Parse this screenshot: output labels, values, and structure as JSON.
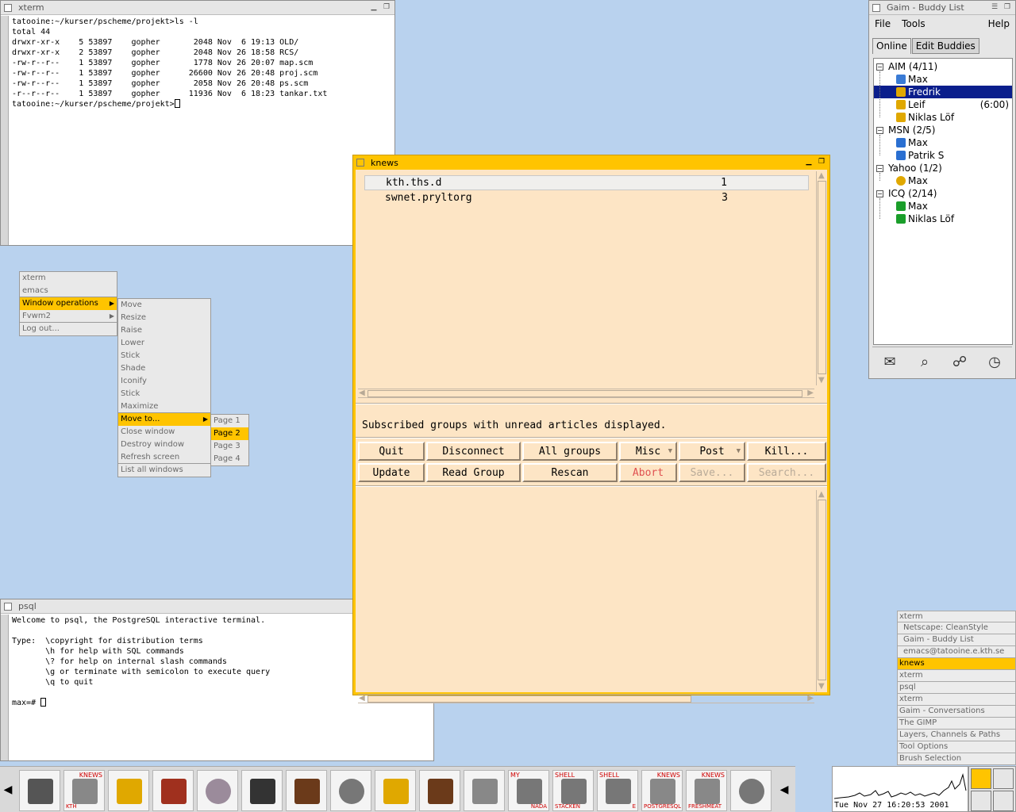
{
  "xterm_top": {
    "title": "xterm",
    "lines": [
      "tatooine:~/kurser/pscheme/projekt>ls -l",
      "total 44",
      "drwxr-xr-x    5 53897    gopher       2048 Nov  6 19:13 OLD/",
      "drwxr-xr-x    2 53897    gopher       2048 Nov 26 18:58 RCS/",
      "-rw-r--r--    1 53897    gopher       1778 Nov 26 20:07 map.scm",
      "-rw-r--r--    1 53897    gopher      26600 Nov 26 20:48 proj.scm",
      "-rw-r--r--    1 53897    gopher       2058 Nov 26 20:48 ps.scm",
      "-r--r--r--    1 53897    gopher      11936 Nov  6 18:23 tankar.txt"
    ],
    "prompt": "tatooine:~/kurser/pscheme/projekt>"
  },
  "psql": {
    "title": "psql",
    "lines": [
      "Welcome to psql, the PostgreSQL interactive terminal.",
      "",
      "Type:  \\copyright for distribution terms",
      "       \\h for help with SQL commands",
      "       \\? for help on internal slash commands",
      "       \\g or terminate with semicolon to execute query",
      "       \\q to quit",
      ""
    ],
    "prompt": "max=# "
  },
  "root_menu": {
    "items": [
      "xterm",
      "emacs",
      "Window operations",
      "Fvwm2",
      "Log out..."
    ]
  },
  "winops_menu": {
    "items": [
      "Move",
      "Resize",
      "Raise",
      "Lower",
      "Stick",
      "Shade",
      "Iconify",
      "Stick",
      "Maximize",
      "Move to...",
      "Close window",
      "Destroy window",
      "Refresh screen",
      "List all windows"
    ]
  },
  "moveto_menu": {
    "items": [
      "Page 1",
      "Page 2",
      "Page 3",
      "Page 4"
    ]
  },
  "knews": {
    "title": "knews",
    "groups": [
      {
        "name": "kth.ths.d",
        "count": "1"
      },
      {
        "name": "swnet.pryltorg",
        "count": "3"
      }
    ],
    "status": "Subscribed groups with unread articles displayed.",
    "buttons_row1": [
      "Quit",
      "Disconnect",
      "All groups",
      "Misc",
      "Post",
      "Kill..."
    ],
    "buttons_row2": [
      "Update",
      "Read Group",
      "Rescan",
      "Abort",
      "Save...",
      "Search..."
    ]
  },
  "gaim": {
    "title": "Gaim - Buddy List",
    "menu": [
      "File",
      "Tools",
      "Help"
    ],
    "tabs": [
      "Online",
      "Edit Buddies"
    ],
    "groups": [
      {
        "name": "AIM (4/11)",
        "buddies": [
          {
            "name": "Max",
            "extra": ""
          },
          {
            "name": "Fredrik",
            "extra": ""
          },
          {
            "name": "Leif",
            "extra": "(6:00)"
          },
          {
            "name": "Niklas Löf",
            "extra": ""
          }
        ]
      },
      {
        "name": "MSN (2/5)",
        "buddies": [
          {
            "name": "Max",
            "extra": ""
          },
          {
            "name": "Patrik S",
            "extra": ""
          }
        ]
      },
      {
        "name": "Yahoo (1/2)",
        "buddies": [
          {
            "name": "Max",
            "extra": ""
          }
        ]
      },
      {
        "name": "ICQ (2/14)",
        "buddies": [
          {
            "name": "Max",
            "extra": ""
          },
          {
            "name": "Niklas Löf",
            "extra": ""
          }
        ]
      }
    ]
  },
  "window_list": [
    "xterm",
    "Netscape: CleanStyle",
    "Gaim - Buddy List",
    "emacs@tatooine.e.kth.se",
    "knews",
    "xterm",
    "psql",
    "xterm",
    "Gaim - Conversations",
    "The GIMP",
    "Layers, Channels & Paths",
    "Tool Options",
    "Brush Selection"
  ],
  "taskbar": {
    "labels": [
      {
        "top": "",
        "bottom": ""
      },
      {
        "top": "KNEWS",
        "bottom": "KTH"
      },
      {
        "top": "",
        "bottom": ""
      },
      {
        "top": "",
        "bottom": ""
      },
      {
        "top": "",
        "bottom": ""
      },
      {
        "top": "",
        "bottom": ""
      },
      {
        "top": "",
        "bottom": ""
      },
      {
        "top": "",
        "bottom": ""
      },
      {
        "top": "",
        "bottom": ""
      },
      {
        "top": "",
        "bottom": ""
      },
      {
        "top": "",
        "bottom": ""
      },
      {
        "top": "MY",
        "bottom": "NADA"
      },
      {
        "top": "SHELL",
        "bottom": "STACKEN"
      },
      {
        "top": "SHELL",
        "bottom": "E"
      },
      {
        "top": "KNEWS",
        "bottom": "POSTGRESQL"
      },
      {
        "top": "KNEWS",
        "bottom": "FRESHMEAT"
      },
      {
        "top": "",
        "bottom": ""
      }
    ],
    "clock": "Tue Nov 27 16:20:53 2001"
  },
  "colors": {
    "accent": "#ffc400",
    "desktop": "#b9d2ee",
    "knews_bg": "#fde5c5",
    "selection": "#0a1e8c"
  }
}
